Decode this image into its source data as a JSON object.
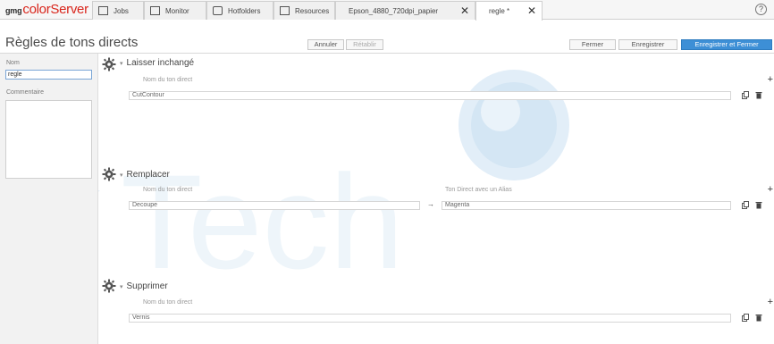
{
  "app": {
    "logo_prefix": "gmg",
    "logo_name": "colorServer"
  },
  "tabs": [
    {
      "label": "Jobs",
      "icon": "jobs-icon"
    },
    {
      "label": "Monitor",
      "icon": "monitor-icon"
    },
    {
      "label": "Hotfolders",
      "icon": "hotfolders-icon"
    },
    {
      "label": "Resources",
      "icon": "resources-icon"
    },
    {
      "label": "Epson_4880_720dpi_papier",
      "icon": "",
      "closable": true
    },
    {
      "label": "regle *",
      "icon": "",
      "closable": true,
      "active": true
    }
  ],
  "help_label": "?",
  "page": {
    "title": "Règles de tons directs",
    "buttons": {
      "cancel": "Annuler",
      "restore": "Rétablir",
      "close": "Fermer",
      "save": "Enregistrer",
      "save_close": "Enregistrer et Fermer"
    }
  },
  "left_panel": {
    "name_label": "Nom",
    "name_value": "regle",
    "comment_label": "Commentaire"
  },
  "sections": {
    "keep": {
      "title": "Laisser inchangé",
      "col_label": "Nom du ton direct",
      "value": "CutContour"
    },
    "replace": {
      "title": "Remplacer",
      "col_label": "Nom du ton direct",
      "col_label_2": "Ton Direct avec un Alias",
      "value": "Decoupe",
      "alias": "Magenta"
    },
    "delete": {
      "title": "Supprimer",
      "col_label": "Nom du ton direct",
      "value": "Vernis"
    }
  },
  "colors": {
    "accent": "#3d8fd6",
    "logo_red": "#d9261c",
    "watermark": "#d7e9f6"
  }
}
